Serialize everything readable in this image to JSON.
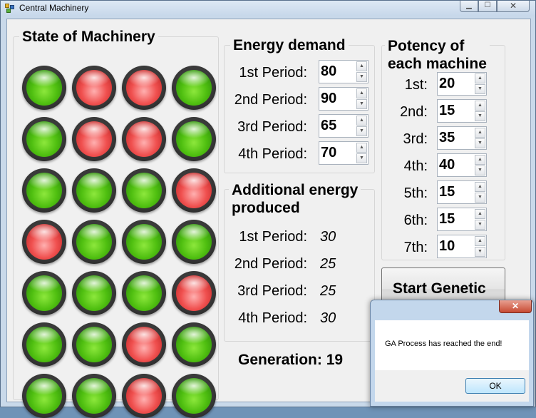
{
  "window": {
    "title": "Central Machinery",
    "minimize_glyph": "▁",
    "maximize_glyph": "☐",
    "close_glyph": "✕"
  },
  "machinery": {
    "title": "State of Machinery",
    "rows": [
      [
        "green",
        "red",
        "red",
        "green"
      ],
      [
        "green",
        "red",
        "red",
        "green"
      ],
      [
        "green",
        "green",
        "green",
        "red"
      ],
      [
        "red",
        "green",
        "green",
        "green"
      ],
      [
        "green",
        "green",
        "green",
        "red"
      ],
      [
        "green",
        "green",
        "red",
        "green"
      ],
      [
        "green",
        "green",
        "red",
        "green"
      ]
    ],
    "colors": {
      "green": "#4fbf10",
      "red": "#f0504f"
    }
  },
  "energy_demand": {
    "title": "Energy demand",
    "periods": [
      {
        "label": "1st Period:",
        "value": "80"
      },
      {
        "label": "2nd Period:",
        "value": "90"
      },
      {
        "label": "3rd Period:",
        "value": "65"
      },
      {
        "label": "4th Period:",
        "value": "70"
      }
    ]
  },
  "additional_energy": {
    "title_line1": "Additional energy",
    "title_line2": "produced",
    "periods": [
      {
        "label": "1st Period:",
        "value": "30"
      },
      {
        "label": "2nd Period:",
        "value": "25"
      },
      {
        "label": "3rd Period:",
        "value": "25"
      },
      {
        "label": "4th Period:",
        "value": "30"
      }
    ]
  },
  "potency": {
    "title_line1": "Potency of",
    "title_line2": "each machine",
    "machines": [
      {
        "label": "1st:",
        "value": "20"
      },
      {
        "label": "2nd:",
        "value": "15"
      },
      {
        "label": "3rd:",
        "value": "35"
      },
      {
        "label": "4th:",
        "value": "40"
      },
      {
        "label": "5th:",
        "value": "15"
      },
      {
        "label": "6th:",
        "value": "15"
      },
      {
        "label": "7th:",
        "value": "10"
      }
    ]
  },
  "generation": {
    "label": "Generation:",
    "value": "19"
  },
  "start_button": {
    "label": "Start Genetic"
  },
  "dialog": {
    "message": "GA Process has reached the end!",
    "ok_label": "OK",
    "close_glyph": "✕"
  }
}
